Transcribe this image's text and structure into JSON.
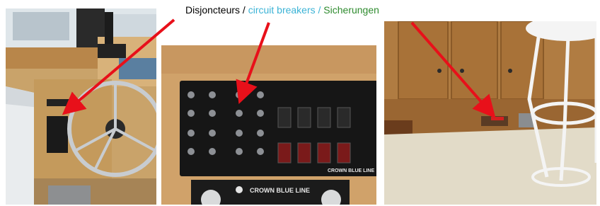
{
  "caption": {
    "french": "Disjoncteurs",
    "separator1": " / ",
    "english": "circuit breakers",
    "separator2": " / ",
    "german": "Sicherungen"
  },
  "photos": [
    {
      "brand_text": ""
    },
    {
      "brand_text_panel": "CROWN BLUE LINE",
      "brand_text_plaque": "CROWN BLUE LINE"
    },
    {
      "brand_text": ""
    }
  ],
  "colors": {
    "french": "#000000",
    "english": "#3bb3d6",
    "german": "#2e8b2e",
    "arrow": "#e8101a"
  }
}
